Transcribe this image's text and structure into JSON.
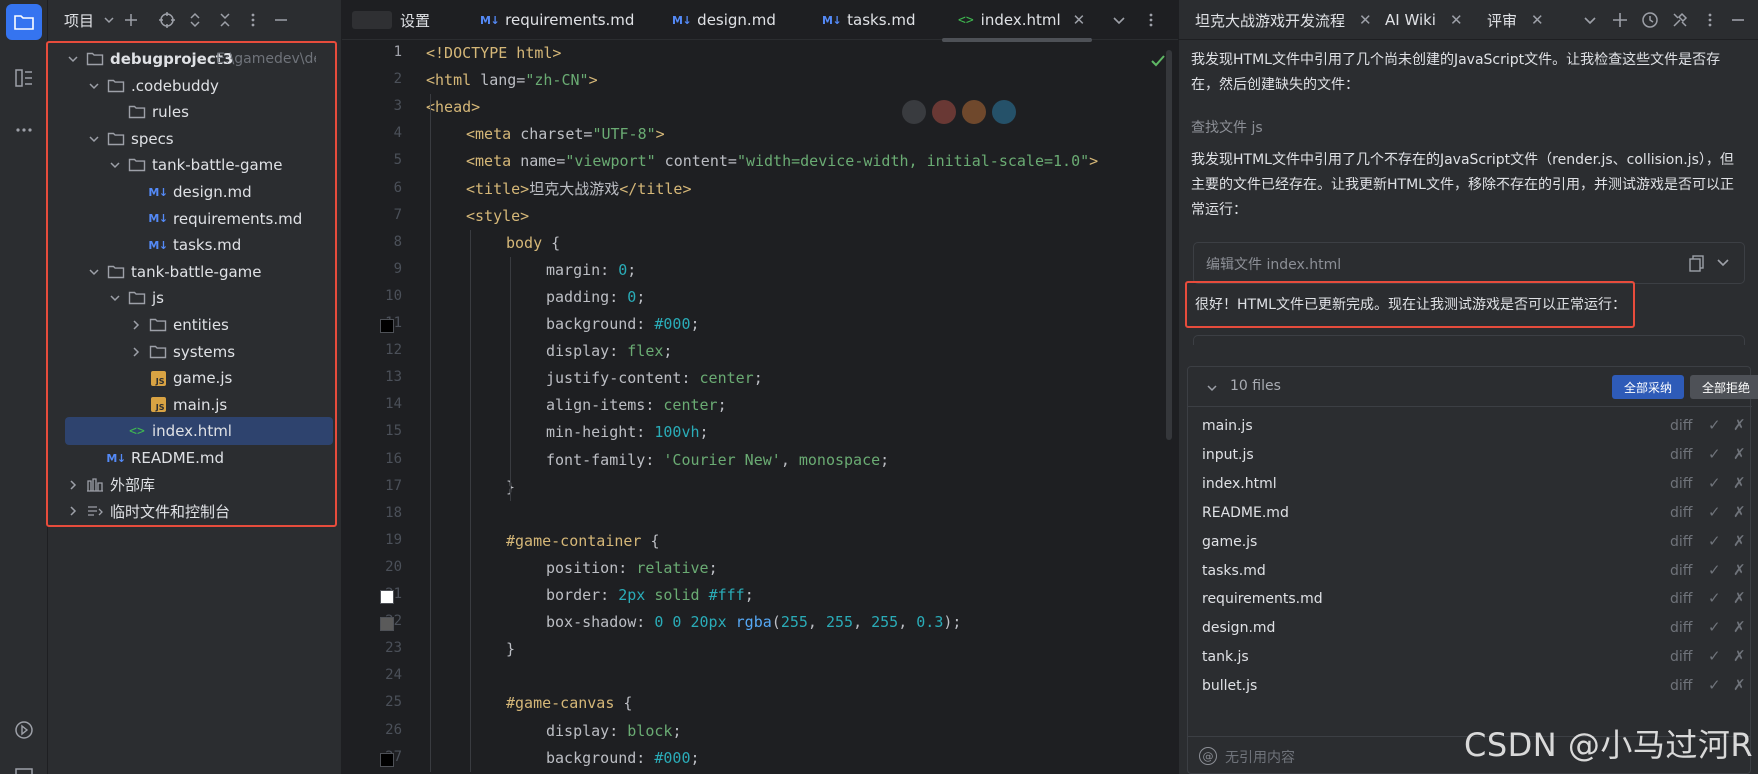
{
  "project_panel": {
    "title": "项目",
    "tree": [
      {
        "label": "debugproject3",
        "hint": "E:\\gamedev\\debu",
        "depth": 0,
        "kind": "folder",
        "expanded": true,
        "bold": true
      },
      {
        "label": ".codebuddy",
        "depth": 1,
        "kind": "folder",
        "expanded": true
      },
      {
        "label": "rules",
        "depth": 2,
        "kind": "folder",
        "expanded": null
      },
      {
        "label": "specs",
        "depth": 1,
        "kind": "folder",
        "expanded": true
      },
      {
        "label": "tank-battle-game",
        "depth": 2,
        "kind": "folder",
        "expanded": true
      },
      {
        "label": "design.md",
        "depth": 3,
        "kind": "md"
      },
      {
        "label": "requirements.md",
        "depth": 3,
        "kind": "md"
      },
      {
        "label": "tasks.md",
        "depth": 3,
        "kind": "md"
      },
      {
        "label": "tank-battle-game",
        "depth": 1,
        "kind": "folder",
        "expanded": true
      },
      {
        "label": "js",
        "depth": 2,
        "kind": "folder",
        "expanded": true
      },
      {
        "label": "entities",
        "depth": 3,
        "kind": "folder",
        "expanded": false
      },
      {
        "label": "systems",
        "depth": 3,
        "kind": "folder",
        "expanded": false
      },
      {
        "label": "game.js",
        "depth": 3,
        "kind": "js"
      },
      {
        "label": "main.js",
        "depth": 3,
        "kind": "js"
      },
      {
        "label": "index.html",
        "depth": 2,
        "kind": "html",
        "selected": true
      },
      {
        "label": "README.md",
        "depth": 1,
        "kind": "md"
      },
      {
        "label": "外部库",
        "depth": 0,
        "kind": "lib",
        "expanded": false
      },
      {
        "label": "临时文件和控制台",
        "depth": 0,
        "kind": "scratch",
        "expanded": false
      }
    ]
  },
  "editor": {
    "tabs": [
      {
        "label": "设置",
        "kind": "settings"
      },
      {
        "label": "requirements.md",
        "kind": "md"
      },
      {
        "label": "design.md",
        "kind": "md"
      },
      {
        "label": "tasks.md",
        "kind": "md"
      },
      {
        "label": "index.html",
        "kind": "html",
        "active": true,
        "closable": true
      }
    ],
    "line_numbers": [
      "1",
      "2",
      "3",
      "4",
      "5",
      "6",
      "7",
      "8",
      "9",
      "10",
      "11",
      "12",
      "13",
      "14",
      "15",
      "16",
      "17",
      "18",
      "19",
      "20",
      "21",
      "22",
      "23",
      "24",
      "25",
      "26",
      "27"
    ],
    "color_swatches": {
      "11": "#000000",
      "21": "#ffffff",
      "22": "#5a5a5a",
      "27": "#000000"
    },
    "code": [
      {
        "indent": 0,
        "tokens": [
          [
            "t-tag",
            "<!DOCTYPE html>"
          ]
        ]
      },
      {
        "indent": 0,
        "tokens": [
          [
            "t-tag",
            "<html "
          ],
          [
            "t-attr",
            "lang="
          ],
          [
            "t-str",
            "\"zh-CN\""
          ],
          [
            "t-tag",
            ">"
          ]
        ]
      },
      {
        "indent": 0,
        "tokens": [
          [
            "t-tag",
            "<head>"
          ]
        ]
      },
      {
        "indent": 1,
        "tokens": [
          [
            "t-tag",
            "<meta "
          ],
          [
            "t-attr",
            "charset="
          ],
          [
            "t-str",
            "\"UTF-8\""
          ],
          [
            "t-tag",
            ">"
          ]
        ]
      },
      {
        "indent": 1,
        "tokens": [
          [
            "t-tag",
            "<meta "
          ],
          [
            "t-attr",
            "name="
          ],
          [
            "t-str",
            "\"viewport\""
          ],
          [
            "t-attr",
            " content="
          ],
          [
            "t-str",
            "\"width=device-width, initial-scale=1.0\""
          ],
          [
            "t-tag",
            ">"
          ]
        ]
      },
      {
        "indent": 1,
        "tokens": [
          [
            "t-tag",
            "<title>"
          ],
          [
            "t-prop",
            "坦克大战游戏"
          ],
          [
            "t-tag",
            "</title>"
          ]
        ]
      },
      {
        "indent": 1,
        "tokens": [
          [
            "t-tag",
            "<style>"
          ]
        ]
      },
      {
        "indent": 2,
        "tokens": [
          [
            "t-sel",
            "body "
          ],
          [
            "t-prop",
            "{"
          ]
        ]
      },
      {
        "indent": 3,
        "tokens": [
          [
            "t-prop",
            "margin: "
          ],
          [
            "t-num",
            "0"
          ],
          [
            "t-prop",
            ";"
          ]
        ]
      },
      {
        "indent": 3,
        "tokens": [
          [
            "t-prop",
            "padding: "
          ],
          [
            "t-num",
            "0"
          ],
          [
            "t-prop",
            ";"
          ]
        ]
      },
      {
        "indent": 3,
        "tokens": [
          [
            "t-prop",
            "background: "
          ],
          [
            "t-hex",
            "#000"
          ],
          [
            "t-prop",
            ";"
          ]
        ]
      },
      {
        "indent": 3,
        "tokens": [
          [
            "t-prop",
            "display: "
          ],
          [
            "t-kw",
            "flex"
          ],
          [
            "t-prop",
            ";"
          ]
        ]
      },
      {
        "indent": 3,
        "tokens": [
          [
            "t-prop",
            "justify-content: "
          ],
          [
            "t-kw",
            "center"
          ],
          [
            "t-prop",
            ";"
          ]
        ]
      },
      {
        "indent": 3,
        "tokens": [
          [
            "t-prop",
            "align-items: "
          ],
          [
            "t-kw",
            "center"
          ],
          [
            "t-prop",
            ";"
          ]
        ]
      },
      {
        "indent": 3,
        "tokens": [
          [
            "t-prop",
            "min-height: "
          ],
          [
            "t-num",
            "100vh"
          ],
          [
            "t-prop",
            ";"
          ]
        ]
      },
      {
        "indent": 3,
        "tokens": [
          [
            "t-prop",
            "font-family: "
          ],
          [
            "t-str",
            "'Courier New'"
          ],
          [
            "t-prop",
            ", "
          ],
          [
            "t-kw",
            "monospace"
          ],
          [
            "t-prop",
            ";"
          ]
        ]
      },
      {
        "indent": 2,
        "tokens": [
          [
            "t-prop",
            "}"
          ]
        ]
      },
      {
        "indent": 0,
        "tokens": []
      },
      {
        "indent": 2,
        "tokens": [
          [
            "t-sel",
            "#game-container "
          ],
          [
            "t-prop",
            "{"
          ]
        ]
      },
      {
        "indent": 3,
        "tokens": [
          [
            "t-prop",
            "position: "
          ],
          [
            "t-kw",
            "relative"
          ],
          [
            "t-prop",
            ";"
          ]
        ]
      },
      {
        "indent": 3,
        "tokens": [
          [
            "t-prop",
            "border: "
          ],
          [
            "t-num",
            "2px "
          ],
          [
            "t-kw",
            "solid "
          ],
          [
            "t-hex",
            "#fff"
          ],
          [
            "t-prop",
            ";"
          ]
        ]
      },
      {
        "indent": 3,
        "tokens": [
          [
            "t-prop",
            "box-shadow: "
          ],
          [
            "t-num",
            "0 0 20px "
          ],
          [
            "t-fn",
            "rgba"
          ],
          [
            "t-prop",
            "("
          ],
          [
            "t-num",
            "255"
          ],
          [
            "t-prop",
            ", "
          ],
          [
            "t-num",
            "255"
          ],
          [
            "t-prop",
            ", "
          ],
          [
            "t-num",
            "255"
          ],
          [
            "t-prop",
            ", "
          ],
          [
            "t-num",
            "0.3"
          ],
          [
            "t-prop",
            ");"
          ]
        ]
      },
      {
        "indent": 2,
        "tokens": [
          [
            "t-prop",
            "}"
          ]
        ]
      },
      {
        "indent": 0,
        "tokens": []
      },
      {
        "indent": 2,
        "tokens": [
          [
            "t-sel",
            "#game-canvas "
          ],
          [
            "t-prop",
            "{"
          ]
        ]
      },
      {
        "indent": 3,
        "tokens": [
          [
            "t-prop",
            "display: "
          ],
          [
            "t-kw",
            "block"
          ],
          [
            "t-prop",
            ";"
          ]
        ]
      },
      {
        "indent": 3,
        "tokens": [
          [
            "t-prop",
            "background: "
          ],
          [
            "t-hex",
            "#000"
          ],
          [
            "t-prop",
            ";"
          ]
        ]
      }
    ]
  },
  "ai_panel": {
    "tabs": [
      {
        "label": "坦克大战游戏开发流程",
        "closable": true
      },
      {
        "label": "AI Wiki",
        "closable": true
      },
      {
        "label": "评审",
        "closable": true
      }
    ],
    "msg1_line1": "我发现HTML文件中引用了几个尚未创建的JavaScript文件。让我检查这些文件是否存",
    "msg1_line2": "在，然后创建缺失的文件：",
    "find_label": "查找文件 js",
    "msg2_line1": "我发现HTML文件中引用了几个不存在的JavaScript文件（render.js、collision.js），但",
    "msg2_line2": "主要的文件已经存在。让我更新HTML文件，移除不存在的引用，并测试游戏是否可以正",
    "msg2_line3": "常运行：",
    "edit_file_label": "编辑文件 index.html",
    "highlight_msg": "很好！HTML文件已更新完成。现在让我测试游戏是否可以正常运行：",
    "files_count": "10 files",
    "accept_all": "全部采纳",
    "reject_all": "全部拒绝",
    "diff_label": "diff",
    "files": [
      "main.js",
      "input.js",
      "index.html",
      "README.md",
      "game.js",
      "tasks.md",
      "requirements.md",
      "design.md",
      "tank.js",
      "bullet.js"
    ],
    "input_placeholder": "无引用内容"
  },
  "watermark": "CSDN @小马过河R"
}
